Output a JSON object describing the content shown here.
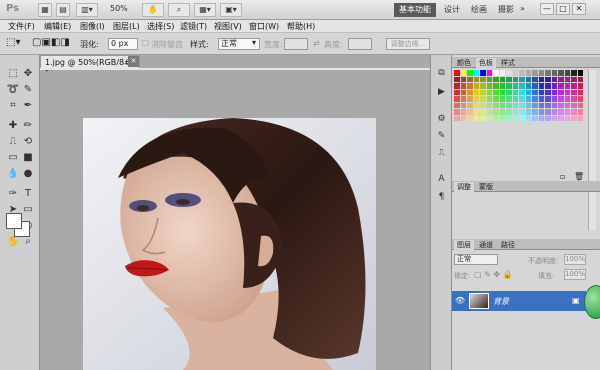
{
  "app": {
    "logo": "Ps",
    "zoom": "50%",
    "workspaces": [
      "基本功能",
      "设计",
      "绘画",
      "摄影"
    ],
    "window_buttons": [
      "—",
      "□",
      "✕"
    ]
  },
  "menu": [
    "文件(F)",
    "编辑(E)",
    "图像(I)",
    "图层(L)",
    "选择(S)",
    "滤镜(T)",
    "视图(V)",
    "窗口(W)",
    "帮助(H)"
  ],
  "options": {
    "feather_label": "羽化:",
    "feather_value": "0 px",
    "antialias_label": "消除锯齿",
    "style_label": "样式:",
    "style_value": "正常",
    "width_label": "宽度:",
    "height_label": "高度:",
    "refine_label": "调整边缘..."
  },
  "document": {
    "tab_title": "1.jpg @ 50%(RGB/8#) *",
    "tab_close": "✕"
  },
  "panels": {
    "top_tabs": [
      "颜色",
      "色板",
      "样式"
    ],
    "active_top_tab": "色板",
    "adjust_tabs": [
      "调整",
      "蒙版"
    ],
    "layer_tabs": [
      "图层",
      "通道",
      "路径"
    ],
    "blend_mode": "正常",
    "opacity_label": "不透明度:",
    "opacity_value": "100%",
    "lock_label": "锁定:",
    "fill_label": "填充:",
    "fill_value": "100%",
    "layer_name": "背景"
  },
  "colors": {
    "accent": "#3b71c1",
    "workspace_active": "#5a5a5a"
  }
}
